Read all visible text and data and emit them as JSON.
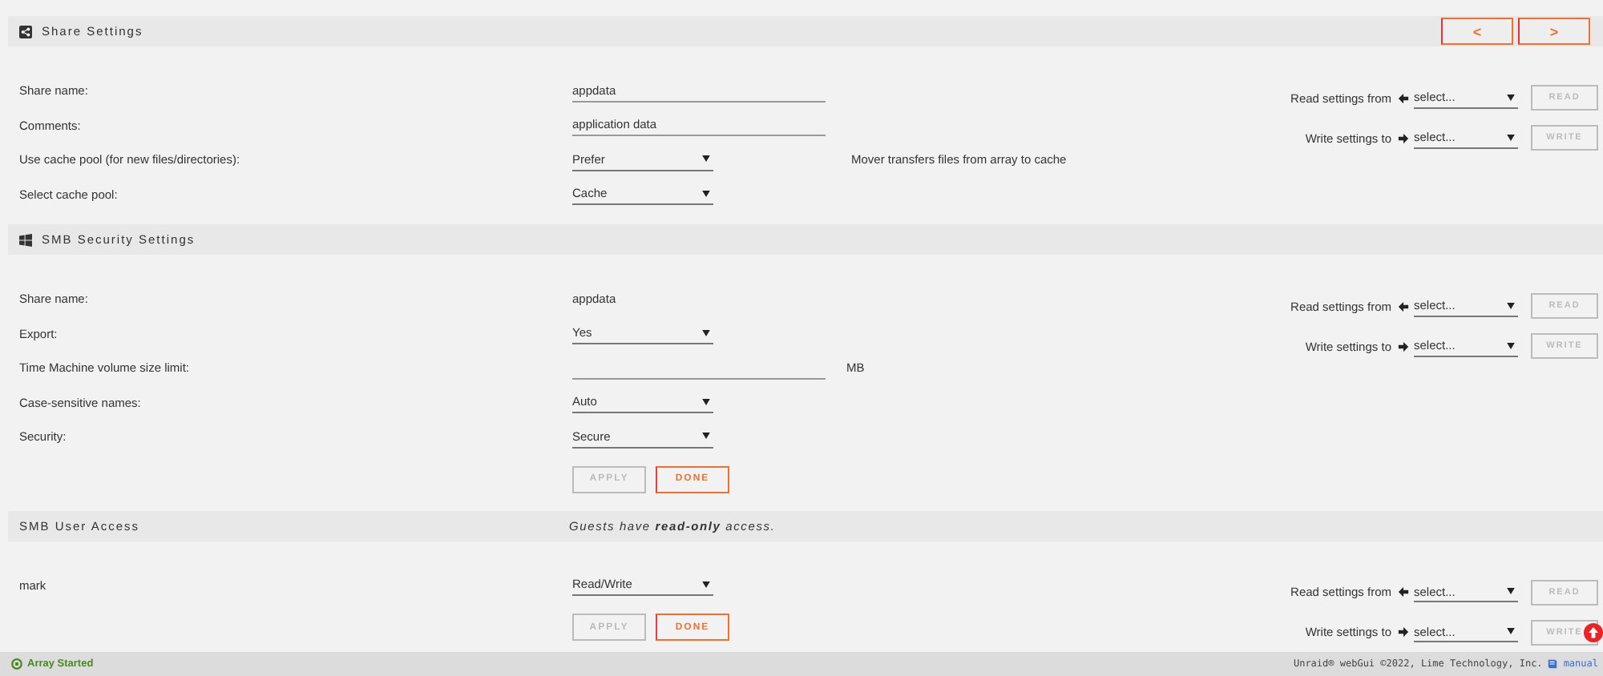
{
  "sections": [
    {
      "title": "Share Settings",
      "nav": [
        {
          "label": "<"
        },
        {
          "label": ">"
        }
      ],
      "rows": [
        {
          "label": "Share name:",
          "kind": "input",
          "value": "appdata"
        },
        {
          "label": "Comments:",
          "kind": "input",
          "value": "application data"
        },
        {
          "label": "Use cache pool (for new files/directories):",
          "kind": "select",
          "value": "Prefer",
          "note": "Mover transfers files from array to cache"
        },
        {
          "label": "Select cache pool:",
          "kind": "select",
          "value": "Cache"
        }
      ],
      "copy": {
        "read_label": "Read settings from",
        "read_select": "select...",
        "read_button": {
          "label": "READ",
          "disabled": true
        },
        "write_label": "Write settings to",
        "write_select": "select...",
        "write_button": {
          "label": "WRITE",
          "disabled": true
        }
      }
    },
    {
      "title": "SMB Security Settings",
      "rows": [
        {
          "label": "Share name:",
          "kind": "text",
          "value": "appdata"
        },
        {
          "label": "Export:",
          "kind": "select",
          "value": "Yes"
        },
        {
          "label": "Time Machine volume size limit:",
          "kind": "input",
          "suffix": "MB"
        },
        {
          "label": "Case-sensitive names:",
          "kind": "select",
          "value": "Auto"
        },
        {
          "label": "Security:",
          "kind": "select",
          "value": "Secure"
        }
      ],
      "actions": [
        {
          "label": "APPLY",
          "disabled": true
        },
        {
          "label": "DONE",
          "disabled": false
        }
      ],
      "copy": {
        "read_label": "Read settings from",
        "read_select": "select...",
        "read_button": {
          "label": "READ",
          "disabled": true
        },
        "write_label": "Write settings to",
        "write_select": "select...",
        "write_button": {
          "label": "WRITE",
          "disabled": true
        }
      }
    },
    {
      "title": "SMB User Access",
      "header_note": "Guests have **read-only** access.",
      "rows": [
        {
          "label": "mark",
          "kind": "select",
          "value": "Read/Write"
        }
      ],
      "actions": [
        {
          "label": "APPLY",
          "disabled": true
        },
        {
          "label": "DONE",
          "disabled": false
        }
      ],
      "copy": {
        "read_label": "Read settings from",
        "read_select": "select...",
        "read_button": {
          "label": "READ",
          "disabled": true
        },
        "write_label": "Write settings to",
        "write_select": "select...",
        "write_button": {
          "label": "WRITE",
          "disabled": true
        }
      }
    }
  ],
  "footer": {
    "status": "Array Started",
    "copyright": "Unraid® webGui ©2022, Lime Technology, Inc.",
    "manual": "manual"
  }
}
